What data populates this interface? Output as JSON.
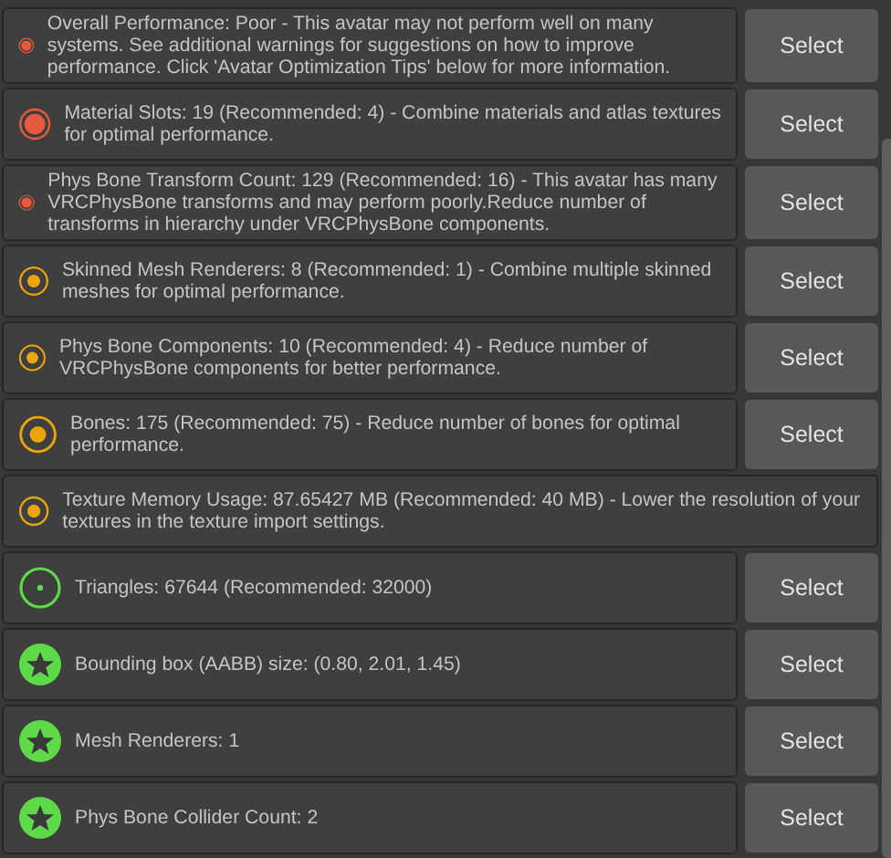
{
  "rows": [
    {
      "kind": "poor",
      "text": "Overall Performance: Poor - This avatar may not perform well on many systems. See additional warnings for suggestions on how to improve performance. Click 'Avatar Optimization Tips' below for more information.",
      "button": "Select"
    },
    {
      "kind": "poor",
      "text": "Material Slots: 19 (Recommended: 4) - Combine materials and atlas textures for optimal performance.",
      "button": "Select"
    },
    {
      "kind": "poor",
      "text": "Phys Bone Transform Count: 129 (Recommended: 16) - This avatar has many VRCPhysBone transforms and may perform poorly.Reduce number of transforms in hierarchy under VRCPhysBone components.",
      "button": "Select"
    },
    {
      "kind": "medium",
      "text": "Skinned Mesh Renderers: 8 (Recommended: 1) - Combine multiple skinned meshes for optimal performance.",
      "button": "Select"
    },
    {
      "kind": "medium",
      "text": "Phys Bone Components: 10 (Recommended: 4) - Reduce number of VRCPhysBone components for better performance.",
      "button": "Select"
    },
    {
      "kind": "medium",
      "text": "Bones: 175 (Recommended: 75) - Reduce number of bones for optimal performance.",
      "button": "Select"
    },
    {
      "kind": "medium",
      "text": "Texture Memory Usage: 87.65427 MB (Recommended: 40 MB) - Lower the resolution of your textures in the texture import settings."
    },
    {
      "kind": "good",
      "text": "Triangles: 67644 (Recommended: 32000)",
      "button": "Select"
    },
    {
      "kind": "excellent",
      "text": "Bounding box (AABB) size: (0.80, 2.01, 1.45)",
      "button": "Select"
    },
    {
      "kind": "excellent",
      "text": "Mesh Renderers: 1",
      "button": "Select"
    },
    {
      "kind": "excellent",
      "text": "Phys Bone Collider Count: 2",
      "button": "Select"
    }
  ]
}
